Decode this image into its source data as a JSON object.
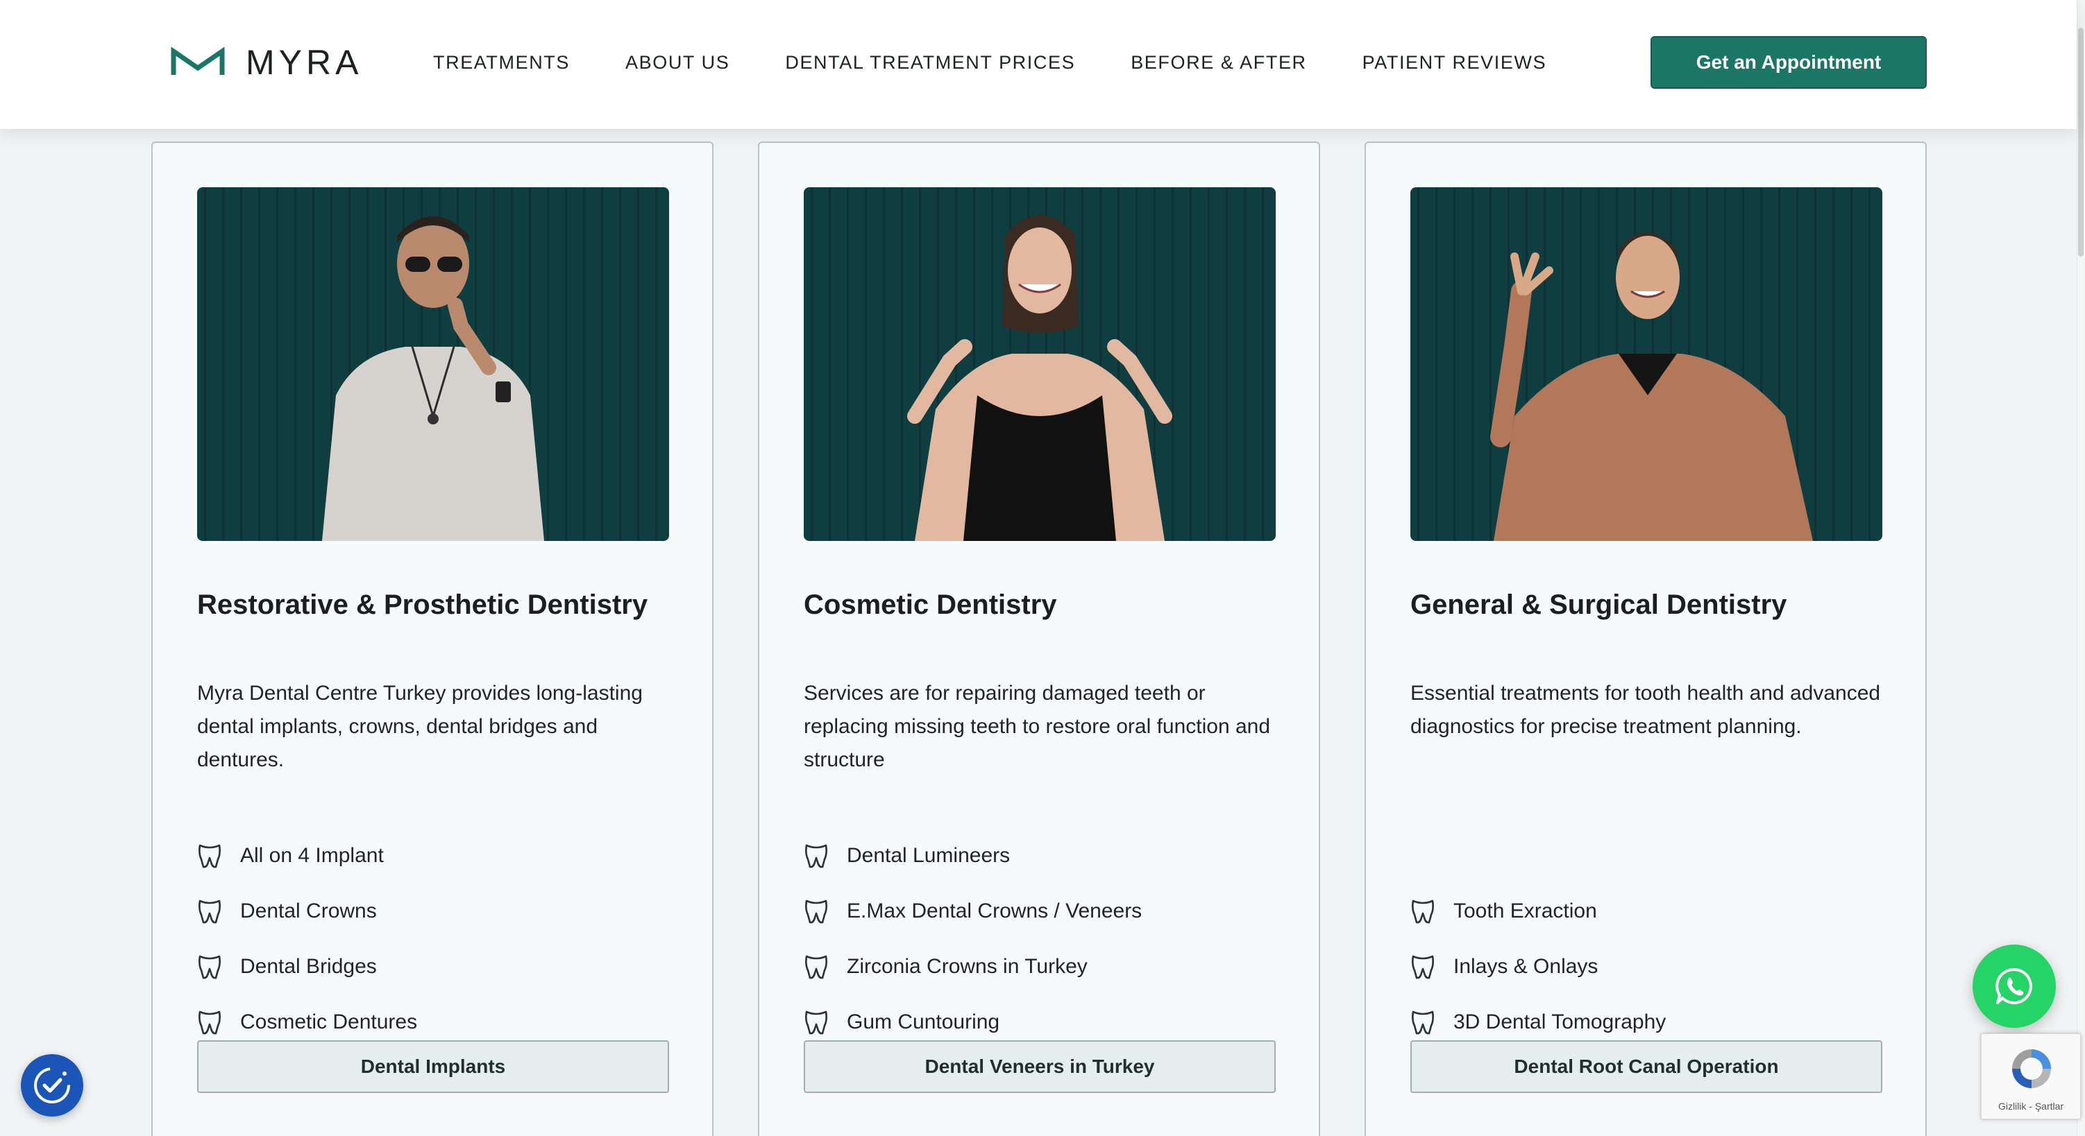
{
  "header": {
    "logo_text": "MYRA",
    "nav": [
      "TREATMENTS",
      "ABOUT US",
      "DENTAL TREATMENT PRICES",
      "BEFORE & AFTER",
      "PATIENT REVIEWS"
    ],
    "cta_label": "Get an Appointment"
  },
  "cards": [
    {
      "title": "Restorative & Prosthetic Dentistry",
      "description": "Myra Dental Centre Turkey provides long-lasting dental implants, crowns, dental bridges and dentures.",
      "features": [
        "All on 4 Implant",
        "Dental Crowns",
        "Dental Bridges",
        "Cosmetic Dentures"
      ],
      "button": "Dental Implants"
    },
    {
      "title": "Cosmetic Dentistry",
      "description": "Services are for repairing damaged teeth or replacing missing teeth to restore oral function and structure",
      "features": [
        "Dental Lumineers",
        "E.Max Dental Crowns / Veneers",
        "Zirconia Crowns in Turkey",
        "Gum Cuntouring"
      ],
      "button": "Dental Veneers in Turkey"
    },
    {
      "title": "General & Surgical Dentistry",
      "description": "Essential treatments for tooth health and advanced diagnostics for precise treatment planning.",
      "features": [
        "Tooth Exraction",
        "Inlays & Onlays",
        "3D Dental Tomography"
      ],
      "button": "Dental Root Canal Operation"
    }
  ],
  "widgets": {
    "recaptcha_text": "Gizlilik - Şartlar"
  },
  "colors": {
    "brand": "#1c7666",
    "image_bg": "#0f3d40",
    "whatsapp": "#25d366",
    "consent": "#1b55b8"
  }
}
